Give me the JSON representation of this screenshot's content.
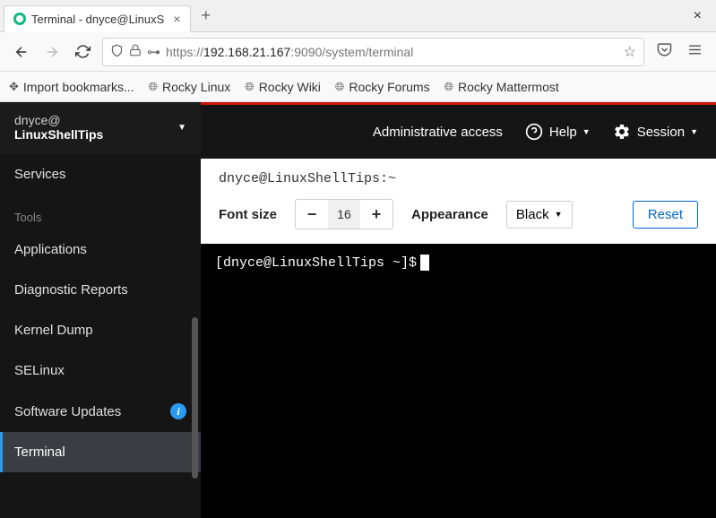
{
  "browser": {
    "tab_title": "Terminal - dnyce@LinuxS",
    "url_prefix": "https://",
    "url_host": "192.168.21.167",
    "url_path": ":9090/system/terminal",
    "bookmarks": [
      {
        "label": "Import bookmarks...",
        "icon": "import"
      },
      {
        "label": "Rocky Linux",
        "icon": "globe"
      },
      {
        "label": "Rocky Wiki",
        "icon": "globe"
      },
      {
        "label": "Rocky Forums",
        "icon": "globe"
      },
      {
        "label": "Rocky Mattermost",
        "icon": "globe"
      }
    ]
  },
  "sidebar": {
    "user": "dnyce@",
    "host": "LinuxShellTips",
    "items_top": [
      {
        "label": "Services"
      }
    ],
    "section_label": "Tools",
    "items_tools": [
      {
        "label": "Applications"
      },
      {
        "label": "Diagnostic Reports"
      },
      {
        "label": "Kernel Dump"
      },
      {
        "label": "SELinux"
      },
      {
        "label": "Software Updates",
        "badge": "info"
      },
      {
        "label": "Terminal",
        "active": true
      }
    ]
  },
  "topbar": {
    "access_text": "Administrative access",
    "help_label": "Help",
    "session_label": "Session"
  },
  "terminal": {
    "title": "dnyce@LinuxShellTips:~",
    "font_size_label": "Font size",
    "font_size_value": "16",
    "appearance_label": "Appearance",
    "appearance_value": "Black",
    "reset_label": "Reset",
    "prompt": "[dnyce@LinuxShellTips ~]$"
  }
}
